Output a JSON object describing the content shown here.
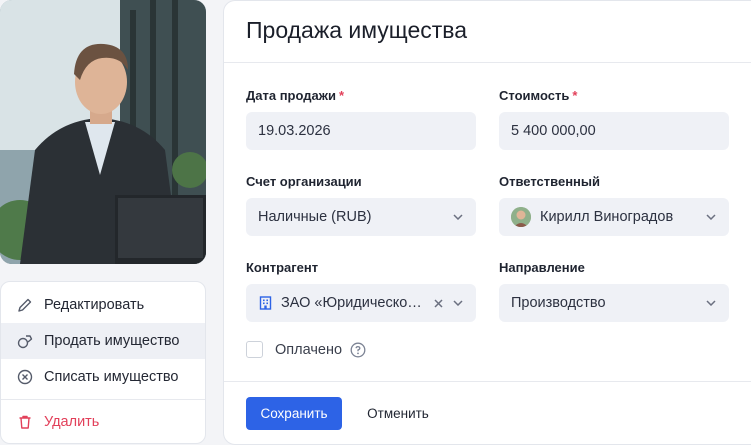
{
  "actions": {
    "edit": "Редактировать",
    "sell": "Продать имущество",
    "writeoff": "Списать имущество",
    "delete": "Удалить"
  },
  "form": {
    "title": "Продажа имущества",
    "sale_date": {
      "label": "Дата продажи",
      "value": "19.03.2026"
    },
    "cost": {
      "label": "Стоимость",
      "value": "5 400 000,00"
    },
    "account": {
      "label": "Счет организации",
      "value": "Наличные (RUB)"
    },
    "responsible": {
      "label": "Ответственный",
      "value": "Кирилл Виноградов"
    },
    "counterparty": {
      "label": "Контрагент",
      "value": "ЗАО «Юридическое..."
    },
    "direction": {
      "label": "Направление",
      "value": "Производство"
    },
    "paid": {
      "label": "Оплачено",
      "checked": false
    },
    "required_mark": "*",
    "save": "Сохранить",
    "cancel": "Отменить"
  },
  "colors": {
    "primary": "#2d63e6",
    "danger": "#e2405a",
    "input_bg": "#eff1f6"
  }
}
